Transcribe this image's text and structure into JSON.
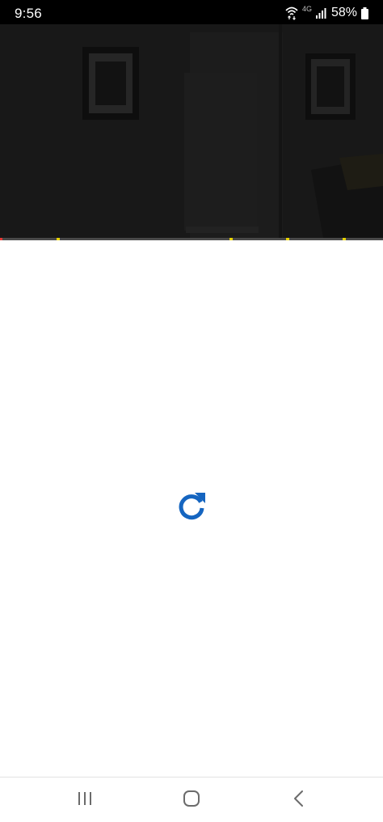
{
  "status_bar": {
    "time": "9:56",
    "network_label": "4G",
    "battery_percent": "58%",
    "icons": [
      "wifi-icon",
      "mobile-data-icon",
      "signal-icon",
      "battery-icon"
    ]
  },
  "video_player": {
    "progress_fraction": 0.0,
    "ad_markers_fraction": [
      0.147,
      0.6,
      0.747,
      0.895
    ],
    "colors": {
      "played": "#e53935",
      "track": "#4a4a4a",
      "ad_marker": "#e8d400"
    }
  },
  "content": {
    "reload_icon": "reload-icon",
    "accent_color": "#1565c0"
  },
  "nav_bar": {
    "buttons": [
      "recent-apps-icon",
      "home-icon",
      "back-icon"
    ]
  }
}
